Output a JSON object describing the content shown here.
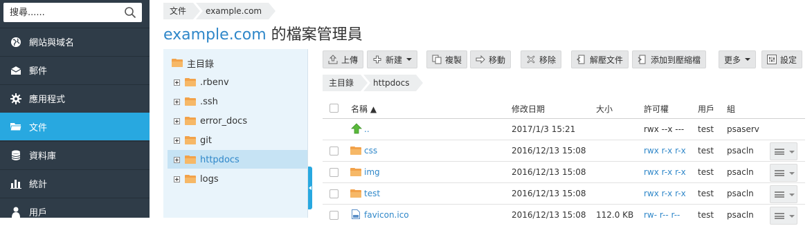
{
  "sidebar": {
    "search_placeholder": "搜尋......",
    "items": [
      {
        "label": "網站與域名",
        "icon": "globe-icon"
      },
      {
        "label": "郵件",
        "icon": "envelope-icon"
      },
      {
        "label": "應用程式",
        "icon": "gear-icon"
      },
      {
        "label": "文件",
        "icon": "folder-icon",
        "active": true
      },
      {
        "label": "資料庫",
        "icon": "database-icon"
      },
      {
        "label": "統計",
        "icon": "bar-chart-icon"
      },
      {
        "label": "用戶",
        "icon": "user-icon"
      }
    ]
  },
  "top_breadcrumb": [
    "文件",
    "example.com"
  ],
  "page_title": {
    "domain": "example.com",
    "suffix": " 的檔案管理員"
  },
  "tree": {
    "root": "主目錄",
    "children": [
      ".rbenv",
      ".ssh",
      "error_docs",
      "git",
      "httpdocs",
      "logs"
    ],
    "selected": "httpdocs"
  },
  "toolbar": {
    "upload": "上傳",
    "new": "新建",
    "copy": "複製",
    "move": "移動",
    "remove": "移除",
    "extract": "解壓文件",
    "add_to_archive": "添加到壓縮檔",
    "more": "更多",
    "settings": "設定"
  },
  "path_breadcrumb": [
    "主目錄",
    "httpdocs"
  ],
  "table": {
    "headers": {
      "name": "名稱",
      "modified": "修改日期",
      "size": "大小",
      "perms": "許可權",
      "user": "用戶",
      "group": "組"
    },
    "rows": [
      {
        "name": "..",
        "type": "up",
        "modified": "2017/1/3 15:21",
        "size": "",
        "perms": "rwx --x ---",
        "user": "test",
        "group": "psaserv"
      },
      {
        "name": "css",
        "type": "folder",
        "modified": "2016/12/13 15:08",
        "size": "",
        "perms": "rwx r-x r-x",
        "user": "test",
        "group": "psacln"
      },
      {
        "name": "img",
        "type": "folder",
        "modified": "2016/12/13 15:08",
        "size": "",
        "perms": "rwx r-x r-x",
        "user": "test",
        "group": "psacln"
      },
      {
        "name": "test",
        "type": "folder",
        "modified": "2016/12/13 15:08",
        "size": "",
        "perms": "rwx r-x r-x",
        "user": "test",
        "group": "psacln"
      },
      {
        "name": "favicon.ico",
        "type": "file",
        "modified": "2016/12/13 15:08",
        "size": "112.0 KB",
        "perms": "rw- r-- r--",
        "user": "test",
        "group": "psacln"
      }
    ]
  },
  "colors": {
    "sidebar_bg": "#2f3c48",
    "accent": "#28a8e0",
    "link": "#2f87c9",
    "folder": "#f2a24a"
  }
}
